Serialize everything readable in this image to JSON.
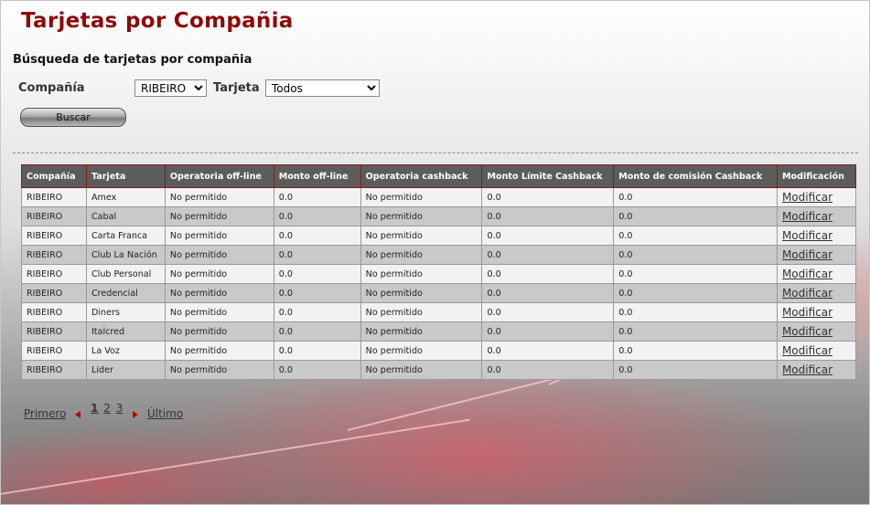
{
  "page": {
    "title": "Tarjetas por Compañia",
    "subtitle": "Búsqueda de tarjetas por compañia"
  },
  "filters": {
    "company_label": "Compañía",
    "company_value": "RIBEIRO",
    "card_label": "Tarjeta",
    "card_value": "Todos",
    "search_button": "Buscar"
  },
  "table": {
    "headers": [
      "Compañía",
      "Tarjeta",
      "Operatoria off-line",
      "Monto off-line",
      "Operatoria cashback",
      "Monto Límite Cashback",
      "Monto de comisión Cashback",
      "Modificación"
    ],
    "rows": [
      [
        "RIBEIRO",
        "Amex",
        "No permitido",
        "0.0",
        "No permitido",
        "0.0",
        "0.0",
        "Modificar"
      ],
      [
        "RIBEIRO",
        "Cabal",
        "No permitido",
        "0.0",
        "No permitido",
        "0.0",
        "0.0",
        "Modificar"
      ],
      [
        "RIBEIRO",
        "Carta Franca",
        "No permitido",
        "0.0",
        "No permitido",
        "0.0",
        "0.0",
        "Modificar"
      ],
      [
        "RIBEIRO",
        "Club La Nación",
        "No permitido",
        "0.0",
        "No permitido",
        "0.0",
        "0.0",
        "Modificar"
      ],
      [
        "RIBEIRO",
        "Club Personal",
        "No permitido",
        "0.0",
        "No permitido",
        "0.0",
        "0.0",
        "Modificar"
      ],
      [
        "RIBEIRO",
        "Credencial",
        "No permitido",
        "0.0",
        "No permitido",
        "0.0",
        "0.0",
        "Modificar"
      ],
      [
        "RIBEIRO",
        "Diners",
        "No permitido",
        "0.0",
        "No permitido",
        "0.0",
        "0.0",
        "Modificar"
      ],
      [
        "RIBEIRO",
        "Italcred",
        "No permitido",
        "0.0",
        "No permitido",
        "0.0",
        "0.0",
        "Modificar"
      ],
      [
        "RIBEIRO",
        "La Voz",
        "No permitido",
        "0.0",
        "No permitido",
        "0.0",
        "0.0",
        "Modificar"
      ],
      [
        "RIBEIRO",
        "Lider",
        "No permitido",
        "0.0",
        "No permitido",
        "0.0",
        "0.0",
        "Modificar"
      ]
    ]
  },
  "pagination": {
    "first": "Primero",
    "pages": [
      "1",
      "2",
      "3"
    ],
    "current": "1",
    "last": "Último"
  },
  "colors": {
    "title": "#8e0a0a",
    "header_bg": "#5c5c5c",
    "header_border": "#8b1a1a",
    "arrow": "#b80000"
  }
}
